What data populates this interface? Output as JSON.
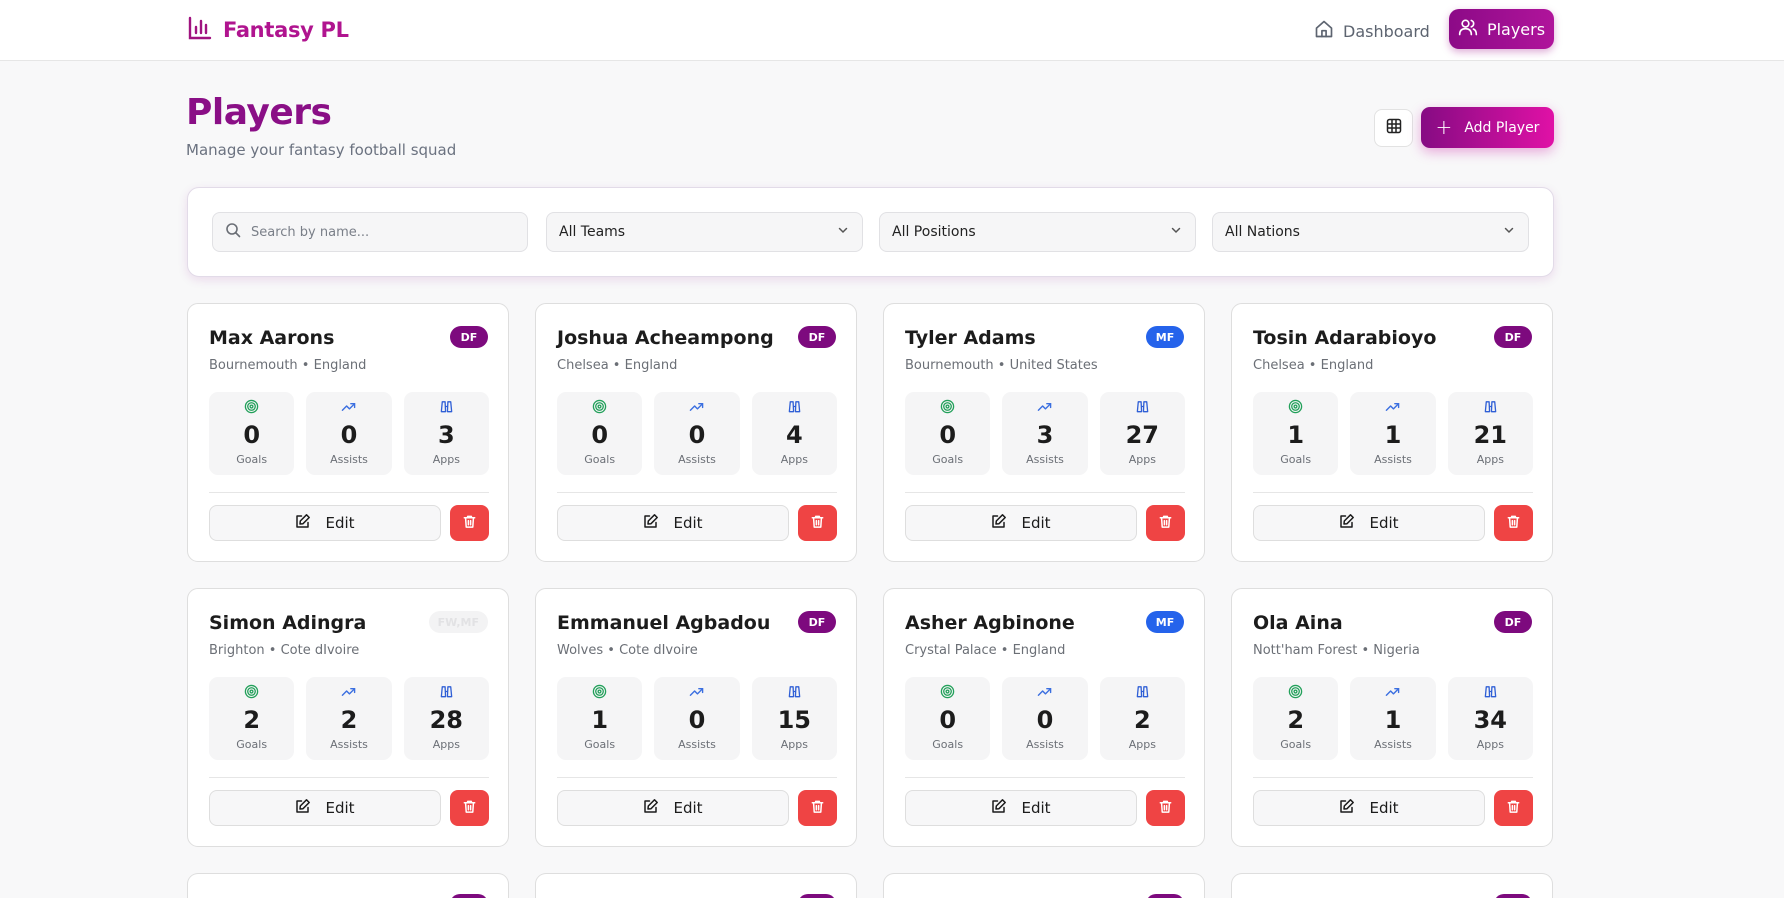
{
  "header": {
    "app_name": "Fantasy PL",
    "nav": [
      {
        "label": "Dashboard",
        "icon": "home-icon",
        "active": false
      },
      {
        "label": "Players",
        "icon": "users-icon",
        "active": true
      }
    ]
  },
  "page": {
    "title": "Players",
    "subtitle": "Manage your fantasy football squad",
    "add_button_label": "Add Player",
    "view_toggle_icon": "table-grid-icon"
  },
  "filters": {
    "search_placeholder": "Search by name...",
    "team_selected": "All Teams",
    "position_selected": "All Positions",
    "nation_selected": "All Nations"
  },
  "stat_labels": {
    "goals": "Goals",
    "assists": "Assists",
    "apps": "Apps"
  },
  "card_actions": {
    "edit_label": "Edit"
  },
  "colors": {
    "brand": "#b0148f",
    "badge_df": "#7d0a7e",
    "badge_mf": "#2563eb",
    "delete": "#ef4444",
    "goals_icon": "#22a05a",
    "assists_icon": "#3b6fe0",
    "apps_icon": "#2f5fd6"
  },
  "players": [
    {
      "name": "Max Aarons",
      "team": "Bournemouth",
      "nation": "England",
      "position": "DF",
      "goals": "0",
      "assists": "0",
      "apps": "3"
    },
    {
      "name": "Joshua Acheampong",
      "team": "Chelsea",
      "nation": "England",
      "position": "DF",
      "goals": "0",
      "assists": "0",
      "apps": "4"
    },
    {
      "name": "Tyler Adams",
      "team": "Bournemouth",
      "nation": "United States",
      "position": "MF",
      "goals": "0",
      "assists": "3",
      "apps": "27"
    },
    {
      "name": "Tosin Adarabioyo",
      "team": "Chelsea",
      "nation": "England",
      "position": "DF",
      "goals": "1",
      "assists": "1",
      "apps": "21"
    },
    {
      "name": "Simon Adingra",
      "team": "Brighton",
      "nation": "Cote dIvoire",
      "position": "FW,MF",
      "goals": "2",
      "assists": "2",
      "apps": "28"
    },
    {
      "name": "Emmanuel Agbadou",
      "team": "Wolves",
      "nation": "Cote dIvoire",
      "position": "DF",
      "goals": "1",
      "assists": "0",
      "apps": "15"
    },
    {
      "name": "Asher Agbinone",
      "team": "Crystal Palace",
      "nation": "England",
      "position": "MF",
      "goals": "0",
      "assists": "0",
      "apps": "2"
    },
    {
      "name": "Ola Aina",
      "team": "Nott'ham Forest",
      "nation": "Nigeria",
      "position": "DF",
      "goals": "2",
      "assists": "1",
      "apps": "34"
    }
  ]
}
